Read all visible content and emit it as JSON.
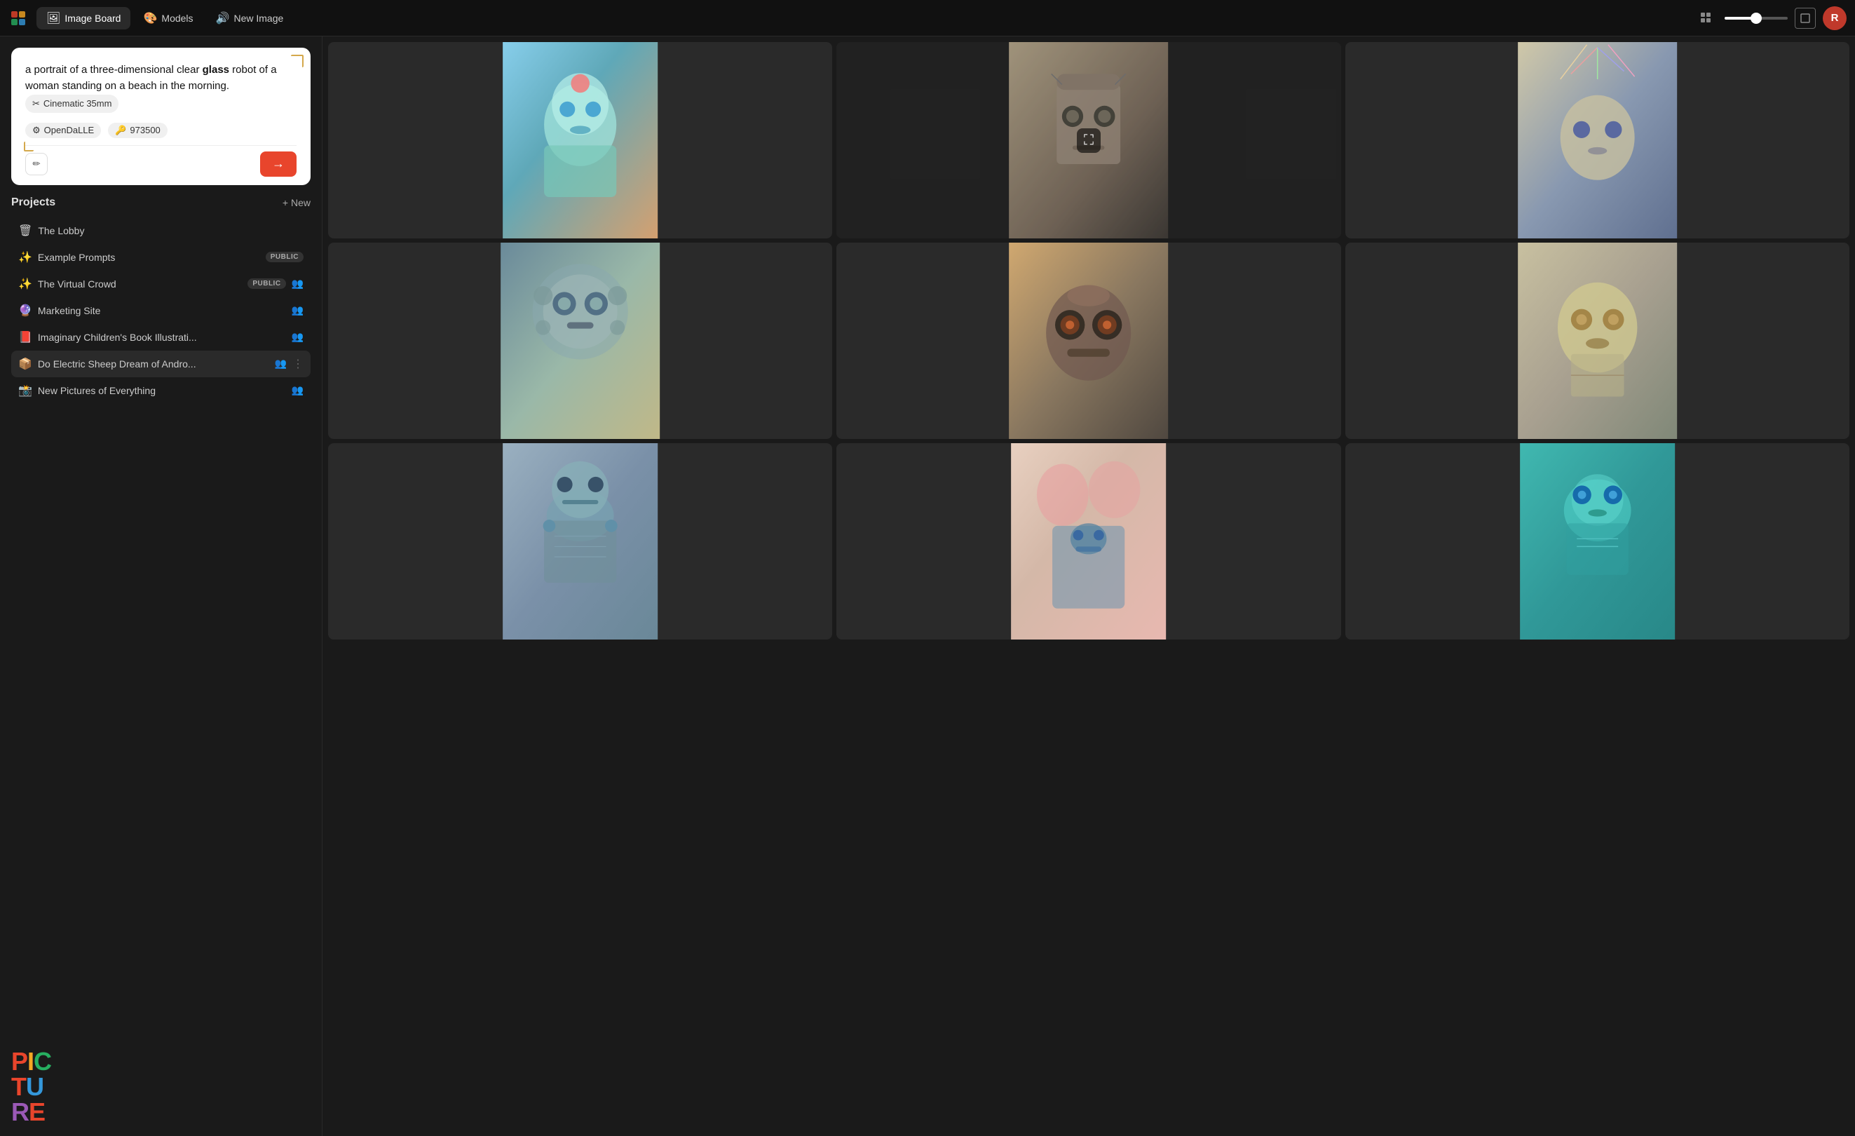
{
  "topbar": {
    "tabs": [
      {
        "id": "image-board",
        "label": "Image Board",
        "icon": "🖼",
        "active": true
      },
      {
        "id": "models",
        "label": "Models",
        "icon": "🎨",
        "active": false
      },
      {
        "id": "new-image",
        "label": "New Image",
        "icon": "🔊",
        "active": false
      }
    ],
    "zoom_value": 50,
    "user_initial": "R"
  },
  "prompt": {
    "text_prefix": "a portrait of a three-dimensional clear ",
    "text_bold": "glass",
    "text_suffix": " robot of a woman standing on a beach in the morning.",
    "style_badge": "Cinematic 35mm",
    "style_icon": "✂",
    "model_badge": "OpenDaLLE",
    "model_icon": "⚙",
    "seed": "973500",
    "seed_icon": "🔑"
  },
  "projects": {
    "title": "Projects",
    "new_label": "+ New",
    "items": [
      {
        "id": "lobby",
        "icon": "🗑",
        "name": "The Lobby",
        "public": false,
        "people": false
      },
      {
        "id": "example",
        "icon": "✨",
        "name": "Example Prompts",
        "public": true,
        "people": false
      },
      {
        "id": "virtual-crowd",
        "icon": "✨",
        "name": "The Virtual Crowd",
        "public": true,
        "people": true
      },
      {
        "id": "marketing",
        "icon": "🔮",
        "name": "Marketing Site",
        "public": false,
        "people": true
      },
      {
        "id": "imaginary-book",
        "icon": "📕",
        "name": "Imaginary Children's Book Illustrati...",
        "public": false,
        "people": true
      },
      {
        "id": "electric-sheep",
        "icon": "📦",
        "name": "Do Electric Sheep Dream of Andro...",
        "public": false,
        "people": true,
        "active": true,
        "more": true
      },
      {
        "id": "another",
        "icon": "📸",
        "name": "New Pictures of Everything",
        "public": false,
        "people": true
      }
    ]
  },
  "logo": {
    "letters": [
      "P",
      "I",
      "C",
      "T",
      "U",
      "R",
      "E"
    ]
  },
  "grid": {
    "images": [
      {
        "id": 1,
        "alt": "Glass robot woman on beach",
        "class": "img-1"
      },
      {
        "id": 2,
        "alt": "Mechanical face portrait",
        "class": "img-2"
      },
      {
        "id": 3,
        "alt": "Robot with wire headdress",
        "class": "img-3"
      },
      {
        "id": 4,
        "alt": "Gear robot face",
        "class": "img-4"
      },
      {
        "id": 5,
        "alt": "Steampunk robot head",
        "class": "img-5"
      },
      {
        "id": 6,
        "alt": "Golden robot portrait",
        "class": "img-6"
      },
      {
        "id": 7,
        "alt": "Circuit robot face",
        "class": "img-7"
      },
      {
        "id": 8,
        "alt": "Pink robot figure",
        "class": "img-8"
      },
      {
        "id": 9,
        "alt": "Teal robot portrait",
        "class": "img-9"
      }
    ]
  }
}
